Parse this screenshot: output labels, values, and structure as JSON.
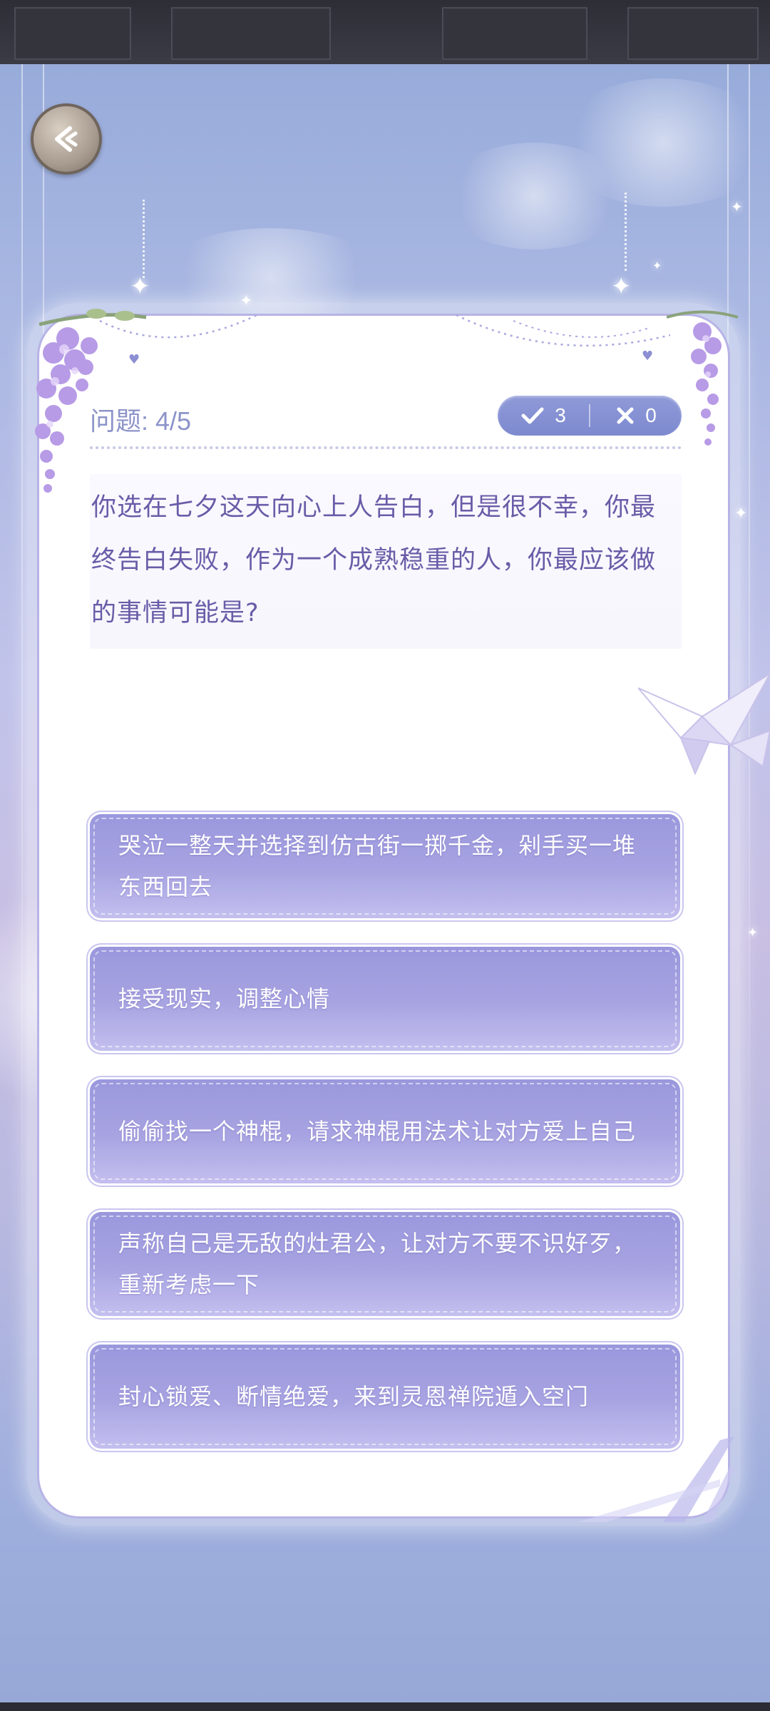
{
  "quiz": {
    "progress_label": "问题: 4/5",
    "correct_count": "3",
    "wrong_count": "0",
    "question": "你选在七夕这天向心上人告白，但是很不幸，你最终告白失败，作为一个成熟稳重的人，你最应该做的事情可能是?",
    "options": [
      {
        "label": "哭泣一整天并选择到仿古街一掷千金，剁手买一堆东西回去"
      },
      {
        "label": "接受现实，调整心情"
      },
      {
        "label": "偷偷找一个神棍，请求神棍用法术让对方爱上自己"
      },
      {
        "label": "声称自己是无敌的灶君公，让对方不要不识好歹，重新考虑一下"
      },
      {
        "label": "封心锁爱、断情绝爱，来到灵恩禅院遁入空门"
      }
    ]
  },
  "icons": {
    "back": "back-arrow-icon",
    "check": "check-icon",
    "cross": "cross-icon"
  },
  "colors": {
    "accent": "#8c93c9",
    "question_text": "#6a5ca8",
    "option_top": "#9a97dd",
    "option_bottom": "#c3bfef",
    "pill": "#8f9ad8"
  }
}
